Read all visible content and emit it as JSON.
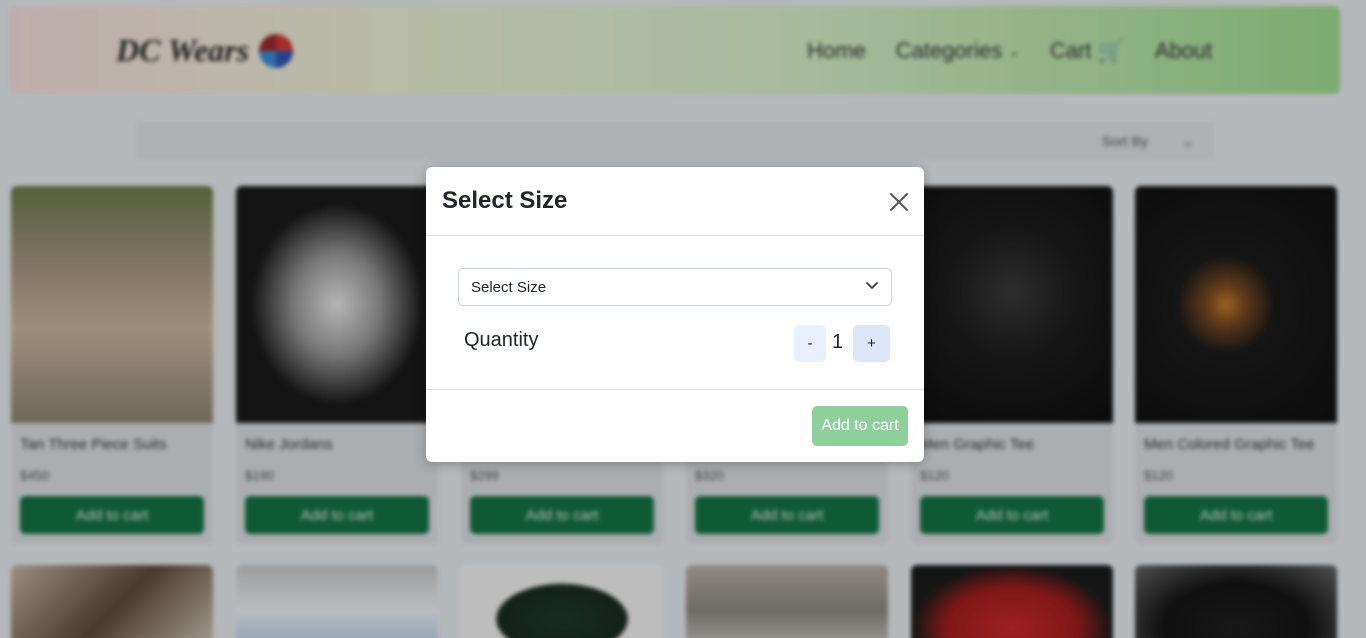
{
  "navbar": {
    "brand": "DC Wears",
    "links": [
      "Home",
      "Categories",
      "Cart",
      "About"
    ]
  },
  "toolbar": {
    "sort_label": "Sort By"
  },
  "products": [
    {
      "title": "Tan Three Piece Suits",
      "price": "$450",
      "button": "Add to cart"
    },
    {
      "title": "Nike Jordans",
      "price": "$190",
      "button": "Add to cart"
    },
    {
      "title": "",
      "price": "$299",
      "button": "Add to cart"
    },
    {
      "title": "",
      "price": "$320",
      "button": "Add to cart"
    },
    {
      "title": "Men Graphic Tee",
      "price": "$120",
      "button": "Add to cart"
    },
    {
      "title": "Men Colored Graphic Tee",
      "price": "$120",
      "button": "Add to cart"
    }
  ],
  "modal": {
    "title": "Select Size",
    "size_select": "Select Size",
    "quantity_label": "Quantity",
    "qty_minus": "-",
    "qty_value": "1",
    "qty_plus": "+",
    "add_button": "Add to cart"
  },
  "colors": {
    "accent_green": "#157347",
    "modal_add_button": "#8fcf9b"
  }
}
